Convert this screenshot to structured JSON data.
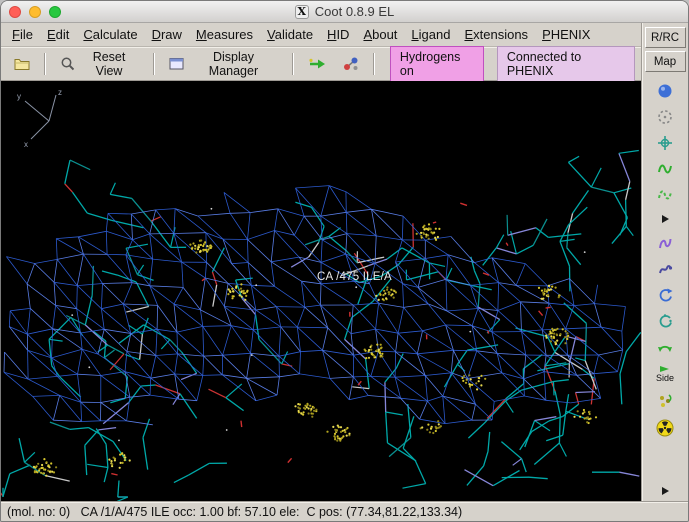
{
  "window": {
    "title": "Coot 0.8.9 EL"
  },
  "menu": {
    "items": [
      {
        "label": "File"
      },
      {
        "label": "Edit"
      },
      {
        "label": "Calculate"
      },
      {
        "label": "Draw"
      },
      {
        "label": "Measures"
      },
      {
        "label": "Validate"
      },
      {
        "label": "HID"
      },
      {
        "label": "About"
      },
      {
        "label": "Ligand"
      },
      {
        "label": "Extensions"
      },
      {
        "label": "PHENIX"
      }
    ]
  },
  "toolbar": {
    "reset_view_label": "Reset View",
    "display_manager_label": "Display Manager",
    "hydrogens_badge": "Hydrogens on",
    "phenix_badge": "Connected to PHENIX",
    "icons": [
      "open-folder-icon",
      "magnifier-icon",
      "display-manager-icon",
      "go-to-atom-arrow-icon",
      "atoms-icon"
    ]
  },
  "sidebar": {
    "rrc_label": "R/RC",
    "map_label": "Map",
    "side_label": "Side",
    "icons": [
      "sphere-icon",
      "dashed-circle-icon",
      "anchor-icon",
      "refine-zone-icon",
      "regularize-zone-icon",
      "expander-triangle-icon",
      "auto-fit-rotamer-icon",
      "rotamers-icon",
      "edit-chi-angles-icon",
      "torsion-general-icon",
      "flip-peptide-icon",
      "side-chain-flip-icon",
      "jiggle-fit-icon",
      "radiation-icon",
      "more-triangle-icon"
    ]
  },
  "canvas": {
    "atom_label": "CA /475 ILE/A",
    "axes": {
      "x": "x",
      "y": "y",
      "z": "z"
    }
  },
  "statusbar": {
    "text": "(mol. no: 0)   CA /1/A/475 ILE occ: 1.00 bf: 57.10 ele:  C pos: (77.34,81.22,133.34)"
  },
  "colors": {
    "mesh_blue": "#2f5fd8",
    "mesh_blue_bright": "#5d83f0",
    "molecule_teal": "#00a8a8",
    "cluster_yellow": "#d6c62e",
    "oxygen_red": "#cc3333",
    "nitrogen_blue": "#8686d8",
    "badge_hydrogens_bg": "#f0a0e6",
    "badge_phenix_bg": "#e6c8ea",
    "chrome_gray": "#d6d2cb",
    "canvas_bg": "#000000",
    "traffic_red": "#ff5f57",
    "traffic_yellow": "#febc2e",
    "traffic_green": "#28c840"
  }
}
